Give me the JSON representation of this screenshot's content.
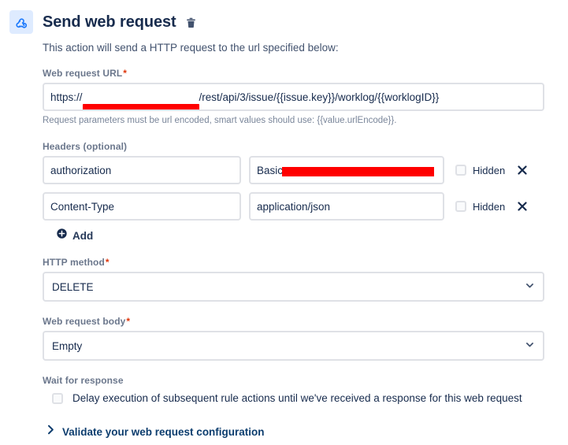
{
  "action": {
    "icon": "webhook-icon",
    "title": "Send web request",
    "delete_icon": "trash-icon",
    "description": "This action will send a HTTP request to the url specified below:"
  },
  "url_field": {
    "label": "Web request URL",
    "required_marker": "*",
    "value_prefix": "https://",
    "value_redacted_domain": "",
    "value_suffix": "/rest/api/3/issue/{{issue.key}}/worklog/{{worklogID}}",
    "hint": "Request parameters must be url encoded, smart values should use: {{value.urlEncode}}."
  },
  "headers": {
    "label": "Headers (optional)",
    "rows": [
      {
        "key": "authorization",
        "value": "Basic ",
        "value_redacted": true,
        "hidden_label": "Hidden",
        "hidden_checked": false,
        "remove_icon": "close-icon"
      },
      {
        "key": "Content-Type",
        "value": "application/json",
        "value_redacted": false,
        "hidden_label": "Hidden",
        "hidden_checked": false,
        "remove_icon": "close-icon"
      }
    ],
    "add_label": "Add",
    "add_icon": "plus-circle-icon"
  },
  "http_method": {
    "label": "HTTP method",
    "required_marker": "*",
    "value": "DELETE",
    "chevron_icon": "chevron-down-icon"
  },
  "web_request_body": {
    "label": "Web request body",
    "required_marker": "*",
    "value": "Empty",
    "chevron_icon": "chevron-down-icon"
  },
  "wait_for_response": {
    "label": "Wait for response",
    "checkbox_label": "Delay execution of subsequent rule actions until we've received a response for this web request",
    "checked": false
  },
  "validate": {
    "label": "Validate your web request configuration",
    "chevron_icon": "chevron-right-icon"
  },
  "colors": {
    "accent_blue": "#0052CC",
    "icon_bg": "#DEEBFF",
    "text_primary": "#172B4D",
    "text_subtle": "#6B778C",
    "border": "#DFE1E6",
    "required_red": "#DE350B",
    "redaction_red": "#FF0000",
    "link_navy": "#0C3D6E"
  }
}
